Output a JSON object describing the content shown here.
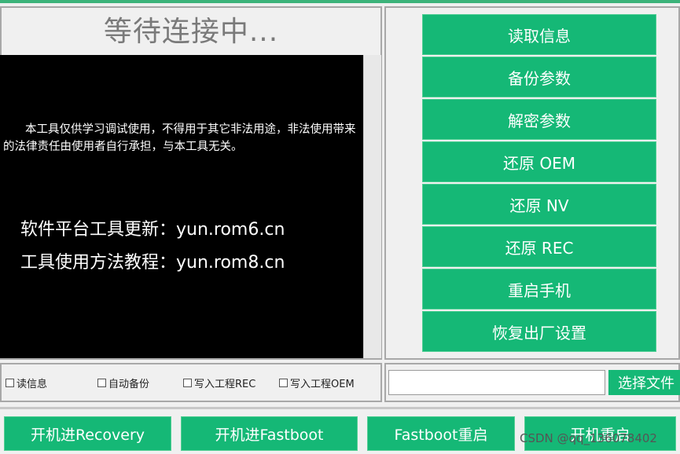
{
  "status": {
    "text": "等待连接中..."
  },
  "console": {
    "disclaimer": "本工具仅供学习调试使用，不得用于其它非法用途，非法使用带来的法律责任由使用者自行承担，与本工具无关。",
    "promo_line1": "软件平台工具更新：yun.rom6.cn",
    "promo_line2": "工具使用方法教程：yun.rom8.cn"
  },
  "actions": [
    {
      "label": "读取信息"
    },
    {
      "label": "备份参数"
    },
    {
      "label": "解密参数"
    },
    {
      "label": "还原 OEM"
    },
    {
      "label": "还原 NV"
    },
    {
      "label": "还原 REC"
    },
    {
      "label": "重启手机"
    },
    {
      "label": "恢复出厂设置"
    }
  ],
  "options": [
    {
      "label": "读信息",
      "checked": false
    },
    {
      "label": "自动备份",
      "checked": false
    },
    {
      "label": "写入工程REC",
      "checked": false
    },
    {
      "label": "写入工程OEM",
      "checked": false
    }
  ],
  "file": {
    "value": "",
    "button_label": "选择文件"
  },
  "bottom": [
    {
      "label": "开机进Recovery"
    },
    {
      "label": "开机进Fastboot"
    },
    {
      "label": "Fastboot重启"
    },
    {
      "label": "开机重启"
    }
  ],
  "watermark": "CSDN @qq_136078402",
  "colors": {
    "accent": "#15b876",
    "console_bg": "#000000"
  }
}
